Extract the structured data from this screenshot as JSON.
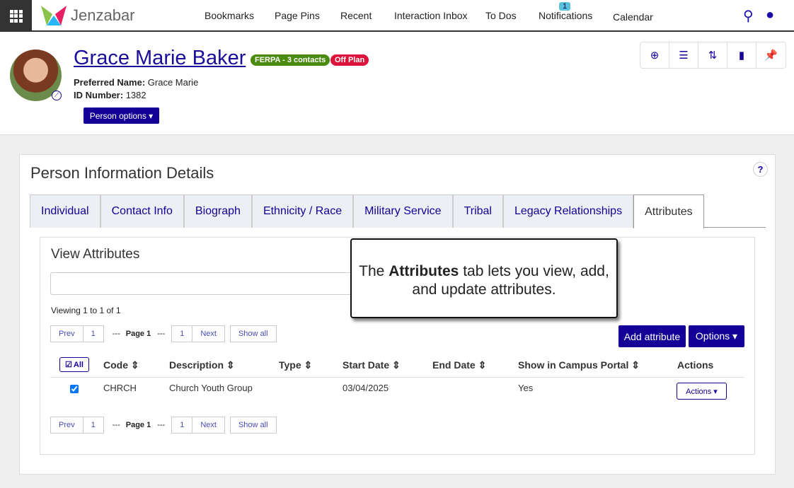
{
  "nav": {
    "logo": "Jenzabar",
    "items": [
      "Bookmarks",
      "Page Pins",
      "Recent",
      "Interaction Inbox",
      "To Dos",
      "Notifications",
      "Calendar"
    ],
    "notification_count": "1"
  },
  "person": {
    "name": "Grace Marie Baker",
    "ferpa": "FERPA - 3 contacts",
    "plan": "Off Plan",
    "preferred_label": "Preferred Name:",
    "preferred": "Grace Marie",
    "id_label": "ID Number:",
    "id": "1382",
    "options": "Person options ▾"
  },
  "page": {
    "title": "Person Information Details",
    "help": "?"
  },
  "tabs": [
    "Individual",
    "Contact Info",
    "Biograph",
    "Ethnicity / Race",
    "Military Service",
    "Tribal",
    "Legacy Relationships",
    "Attributes"
  ],
  "attributes": {
    "title": "View Attributes",
    "viewing": "Viewing 1 to 1 of 1",
    "prev": "Prev",
    "page_num": "1",
    "page_label": "Page 1",
    "dashes": "---",
    "next": "Next",
    "show_all": "Show all",
    "add": "Add attribute",
    "options": "Options ▾",
    "all": "All",
    "columns": [
      "Code",
      "Description",
      "Type",
      "Start Date",
      "End Date",
      "Show in Campus Portal",
      "Actions"
    ],
    "rows": [
      {
        "code": "CHRCH",
        "description": "Church Youth Group",
        "type": "",
        "start": "03/04/2025",
        "end": "",
        "portal": "Yes",
        "actions": "Actions ▾"
      }
    ]
  },
  "callout": {
    "pre": "The ",
    "bold": "Attributes",
    "post": " tab lets you view, add, and update attributes."
  }
}
